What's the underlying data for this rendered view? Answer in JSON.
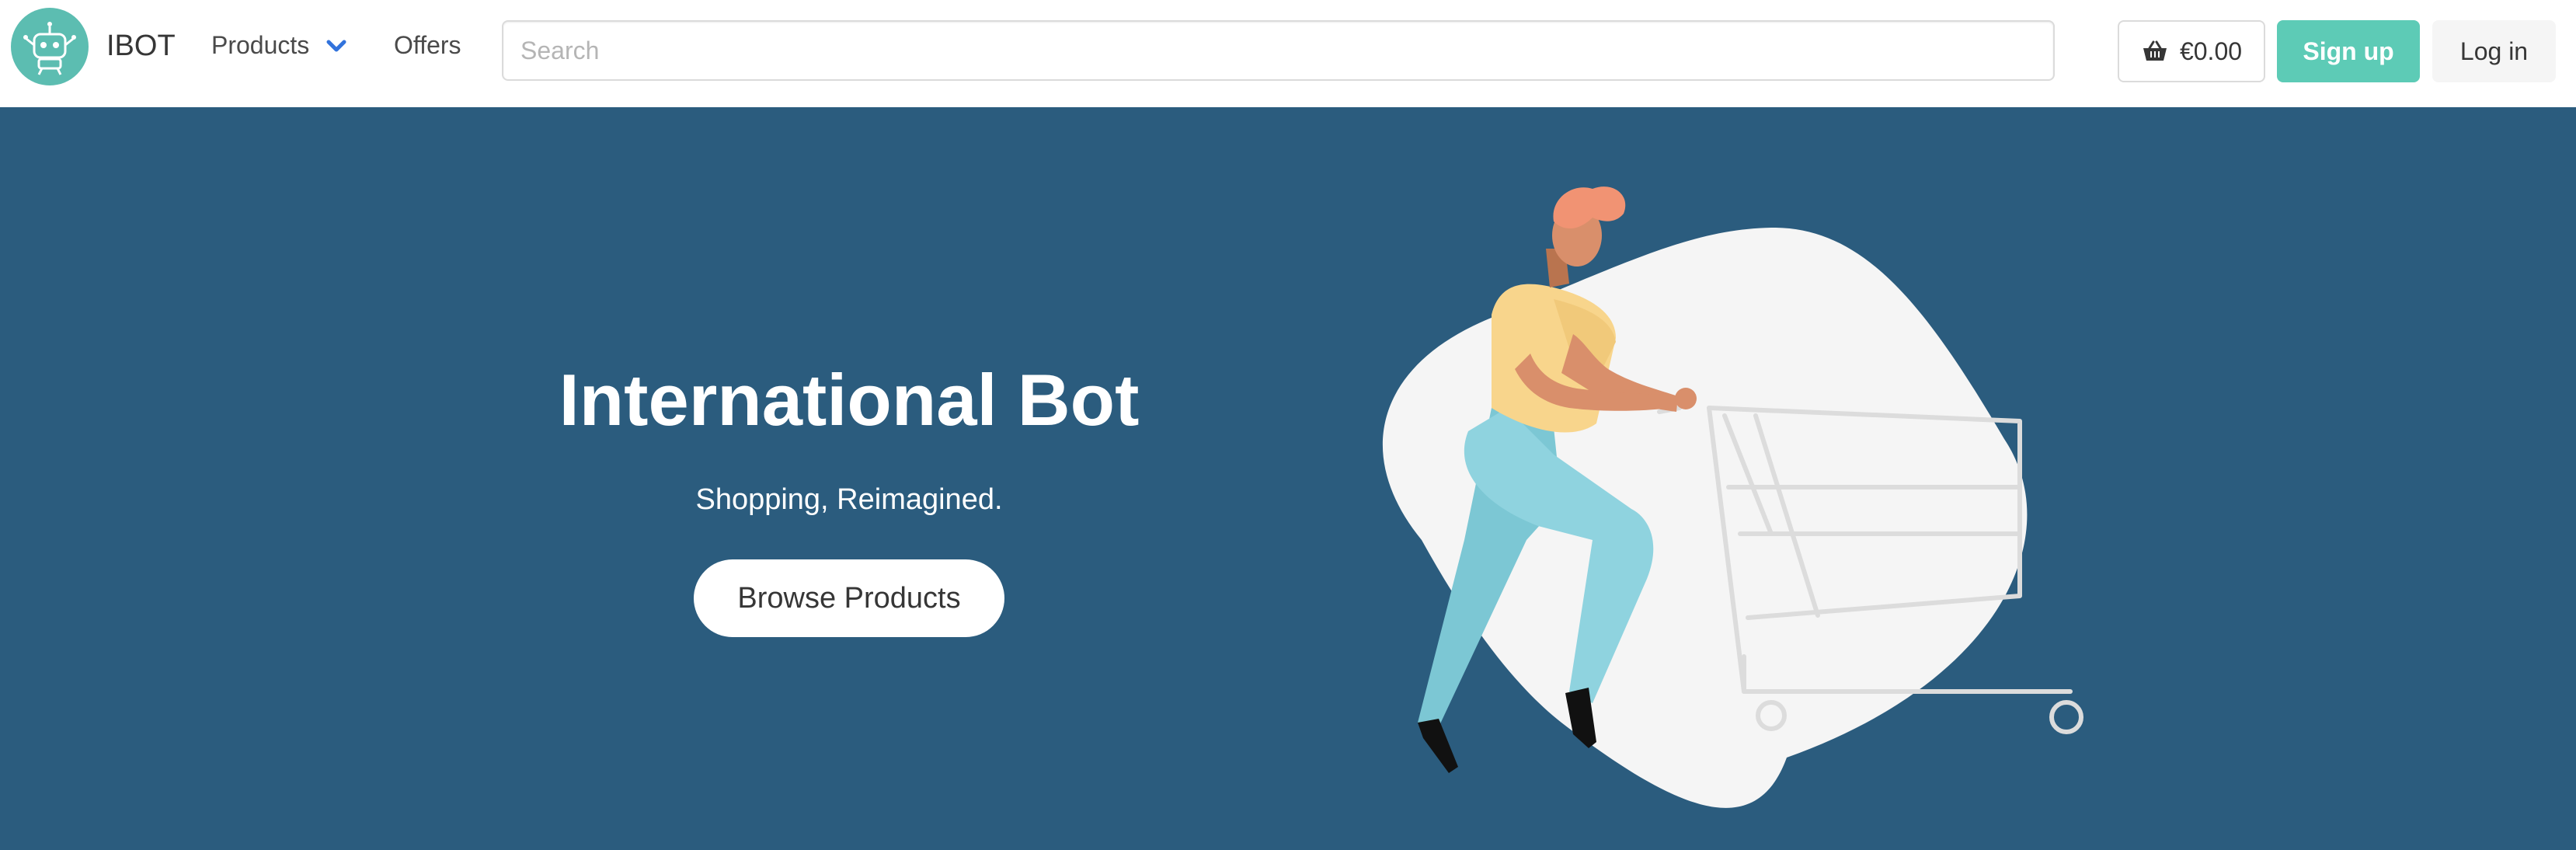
{
  "nav": {
    "brand": "IBOT",
    "logo_icon": "robot-icon",
    "products_label": "Products",
    "products_icon": "chevron-down-icon",
    "offers_label": "Offers"
  },
  "search": {
    "placeholder": "Search",
    "value": ""
  },
  "cart": {
    "icon": "basket-icon",
    "total": "€0.00"
  },
  "auth": {
    "signup_label": "Sign up",
    "login_label": "Log in"
  },
  "hero": {
    "title": "International Bot",
    "subtitle": "Shopping, Reimagined.",
    "cta_label": "Browse Products",
    "illustration": "person-pushing-shopping-cart-illustration"
  },
  "colors": {
    "brand_teal": "#5cbdb1",
    "signup_green": "#5dcbb6",
    "hero_background": "#2b5c7e",
    "chevron_blue": "#3273dc"
  }
}
